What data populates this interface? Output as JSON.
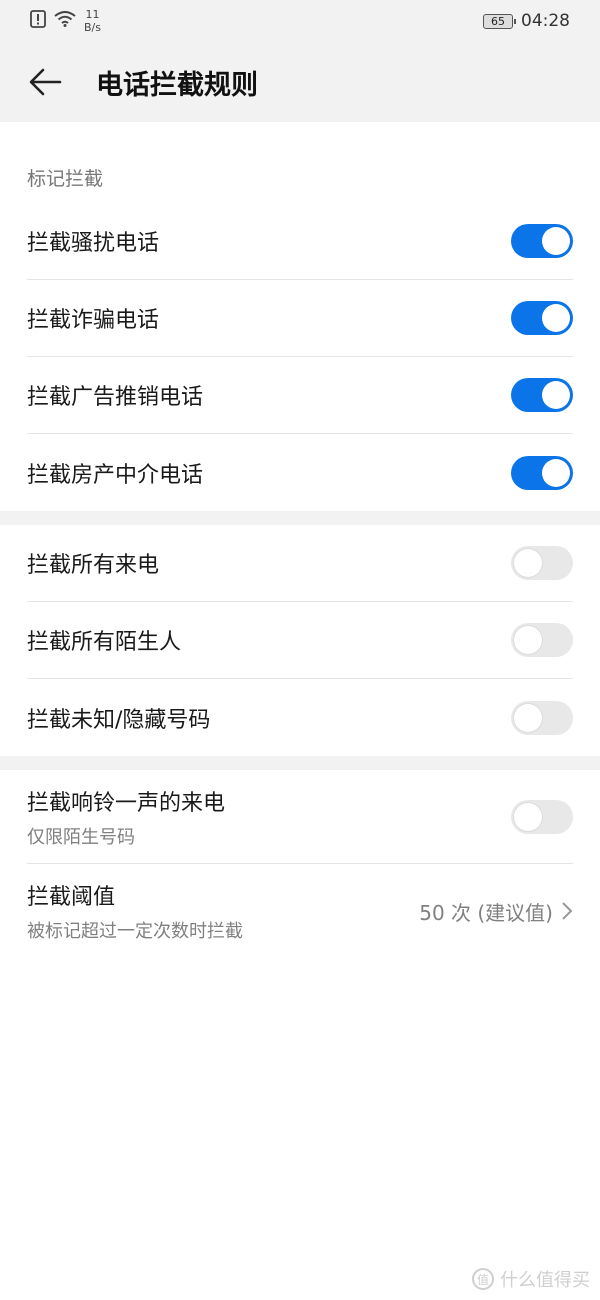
{
  "status_bar": {
    "speed_value": "11",
    "speed_unit": "B/s",
    "battery": "65",
    "time": "04:28"
  },
  "header": {
    "title": "电话拦截规则"
  },
  "section_marked": {
    "label": "标记拦截",
    "items": [
      {
        "label": "拦截骚扰电话",
        "on": true
      },
      {
        "label": "拦截诈骗电话",
        "on": true
      },
      {
        "label": "拦截广告推销电话",
        "on": true
      },
      {
        "label": "拦截房产中介电话",
        "on": true
      }
    ]
  },
  "section_all": {
    "items": [
      {
        "label": "拦截所有来电",
        "on": false
      },
      {
        "label": "拦截所有陌生人",
        "on": false
      },
      {
        "label": "拦截未知/隐藏号码",
        "on": false
      }
    ]
  },
  "section_other": {
    "ring_once": {
      "label": "拦截响铃一声的来电",
      "sub": "仅限陌生号码",
      "on": false
    },
    "threshold": {
      "label": "拦截阈值",
      "sub": "被标记超过一定次数时拦截",
      "value": "50 次 (建议值)"
    }
  },
  "watermark": {
    "text": "什么值得买",
    "badge": "值"
  },
  "colors": {
    "accent": "#0a74e8",
    "toggle_off": "#e8e8e8",
    "header_bg": "#f2f2f2"
  }
}
